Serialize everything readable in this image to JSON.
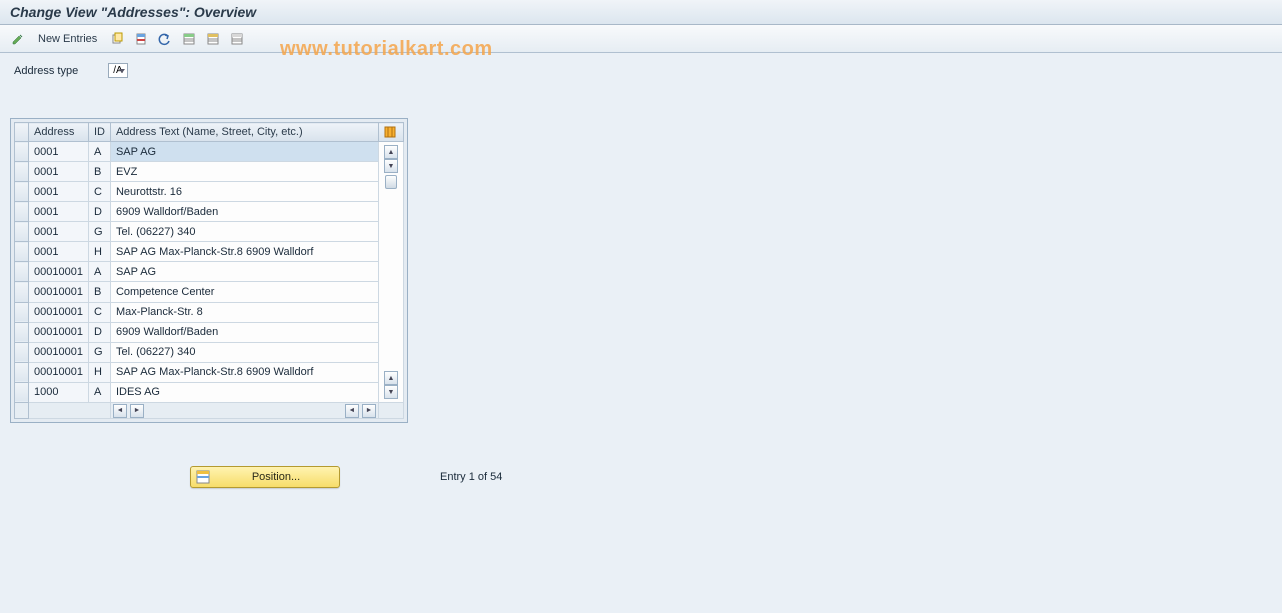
{
  "title": "Change View \"Addresses\": Overview",
  "watermark": "www.tutorialkart.com",
  "toolbar": {
    "new_entries": "New Entries"
  },
  "filter": {
    "label": "Address type",
    "value": "/A"
  },
  "table": {
    "headers": {
      "address": "Address",
      "id": "ID",
      "text": "Address Text (Name, Street, City, etc.)"
    },
    "rows": [
      {
        "address": "0001",
        "id": "A",
        "text": "SAP AG",
        "selected": true
      },
      {
        "address": "0001",
        "id": "B",
        "text": "EVZ"
      },
      {
        "address": "0001",
        "id": "C",
        "text": "Neurottstr. 16"
      },
      {
        "address": "0001",
        "id": "D",
        "text": "6909   Walldorf/Baden"
      },
      {
        "address": "0001",
        "id": "G",
        "text": "Tel. (06227) 340"
      },
      {
        "address": "0001",
        "id": "H",
        "text": "SAP AG Max-Planck-Str.8 6909 Walldorf"
      },
      {
        "address": "00010001",
        "id": "A",
        "text": "SAP AG"
      },
      {
        "address": "00010001",
        "id": "B",
        "text": "Competence Center"
      },
      {
        "address": "00010001",
        "id": "C",
        "text": "Max-Planck-Str. 8"
      },
      {
        "address": "00010001",
        "id": "D",
        "text": "6909   Walldorf/Baden"
      },
      {
        "address": "00010001",
        "id": "G",
        "text": "Tel. (06227) 340"
      },
      {
        "address": "00010001",
        "id": "H",
        "text": "SAP AG Max-Planck-Str.8 6909 Walldorf"
      },
      {
        "address": "1000",
        "id": "A",
        "text": "IDES AG"
      }
    ]
  },
  "footer": {
    "position_label": "Position...",
    "entry_status": "Entry 1 of 54"
  }
}
